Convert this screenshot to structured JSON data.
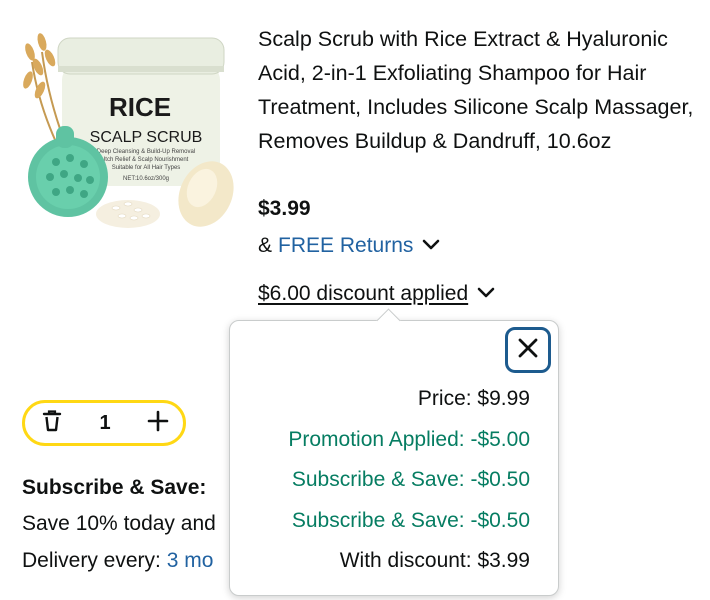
{
  "product": {
    "title": "Scalp Scrub with Rice Extract & Hyaluronic Acid, 2-in-1 Exfoliating Shampoo for Hair Treatment, Includes Silicone Scalp Massager, Removes Buildup & Dandruff, 10.6oz",
    "price": "$3.99",
    "returns_prefix": "&",
    "returns_link": "FREE Returns",
    "discount_text": "$6.00 discount applied",
    "image": {
      "label_big": "RICE",
      "label_small": "SCALP SCRUB",
      "line1": "Deep Cleansing & Build-Up Removal",
      "line2": "Itch Relief & Scalp Nourishment",
      "line3": "Suitable for All Hair Types",
      "net": "NET:10.6oz/300g"
    }
  },
  "cart": {
    "quantity": "1"
  },
  "subscription": {
    "label": "Subscribe & Save:",
    "save_text": "Save 10% today and",
    "delivery_prefix": "Delivery every: ",
    "delivery_link": "3 mo"
  },
  "popover": {
    "rows": [
      "Price: $9.99",
      "Promotion Applied: -$5.00",
      "Subscribe & Save: -$0.50",
      "Subscribe & Save: -$0.50",
      "With discount: $3.99"
    ]
  },
  "colors": {
    "link": "#2162a1",
    "green": "#067d62",
    "stepper_border": "#ffd814",
    "close_border": "#1d5b8e"
  },
  "icons": {
    "returns_chevron": "chevron-down-icon",
    "discount_chevron": "chevron-down-icon",
    "delete": "trash-icon",
    "add": "plus-icon",
    "close": "close-icon"
  }
}
